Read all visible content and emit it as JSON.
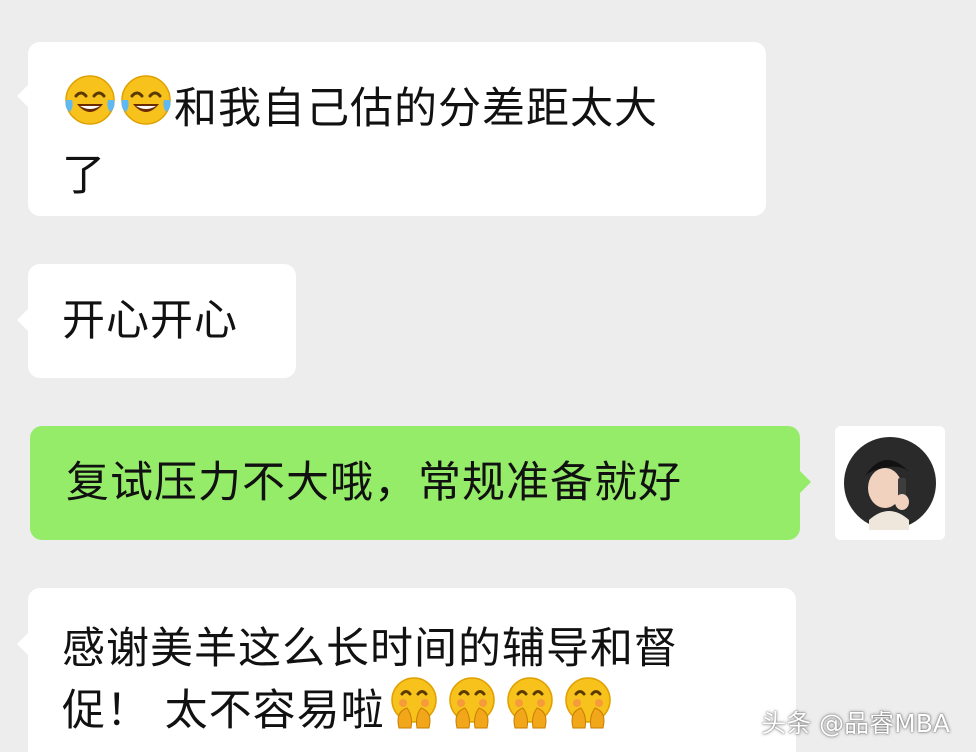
{
  "messages": [
    {
      "id": "msg1",
      "side": "incoming",
      "emoji_prefix": [
        "laughing-tears-icon",
        "laughing-tears-icon"
      ],
      "text_line1": "和我自己估的分差距太大",
      "text_line2": "了"
    },
    {
      "id": "msg2",
      "side": "incoming",
      "text": "开心开心"
    },
    {
      "id": "msg3",
      "side": "outgoing",
      "text": "复试压力不大哦，常规准备就好"
    },
    {
      "id": "msg4",
      "side": "incoming",
      "text_line1": "感谢美羊这么长时间的辅导和督",
      "text_line2": "促！ 太不容易啦",
      "emoji_suffix": [
        "thank-you-face-icon",
        "thank-you-face-icon",
        "thank-you-face-icon",
        "thank-you-face-icon"
      ]
    }
  ],
  "watermark": "头条 @品睿MBA",
  "colors": {
    "background": "#ededed",
    "incoming_bubble": "#ffffff",
    "outgoing_bubble": "#95ec69",
    "text": "#111111"
  }
}
